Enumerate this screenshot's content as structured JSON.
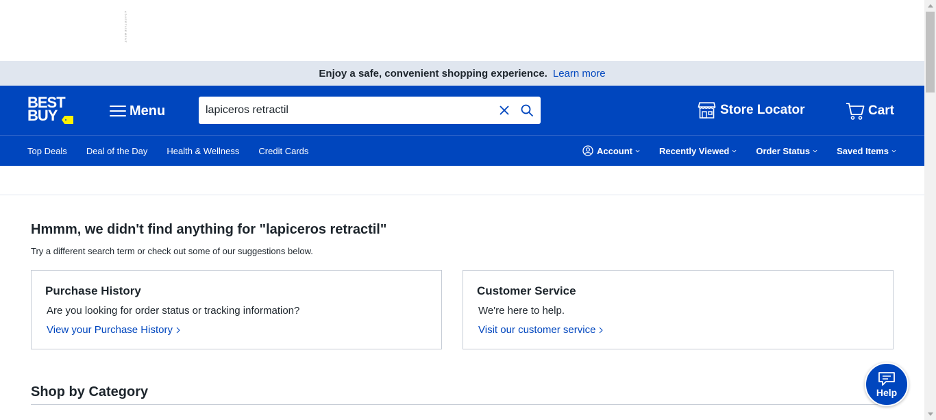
{
  "ad": {
    "label": "ADVERTISEMENT"
  },
  "promo": {
    "text": "Enjoy a safe, convenient shopping experience.",
    "link": "Learn more"
  },
  "header": {
    "logo_line1": "BEST",
    "logo_line2": "BUY",
    "menu_label": "Menu",
    "search_value": "lapiceros retractil",
    "store_locator": "Store Locator",
    "cart": "Cart"
  },
  "subnav": {
    "left": [
      "Top Deals",
      "Deal of the Day",
      "Health & Wellness",
      "Credit Cards"
    ],
    "account": "Account",
    "recently_viewed": "Recently Viewed",
    "order_status": "Order Status",
    "saved_items": "Saved Items"
  },
  "main": {
    "title": "Hmmm, we didn't find anything for \"lapiceros retractil\"",
    "subtitle": "Try a different search term or check out some of our suggestions below.",
    "cards": [
      {
        "title": "Purchase History",
        "text": "Are you looking for order status or tracking information?",
        "link": "View your Purchase History"
      },
      {
        "title": "Customer Service",
        "text": "We're here to help.",
        "link": "Visit our customer service"
      }
    ],
    "shop_by_category": "Shop by Category"
  },
  "help": {
    "label": "Help"
  },
  "colors": {
    "brand_blue": "#0046be",
    "brand_yellow": "#fff200",
    "promo_bg": "#e0e6ef",
    "text": "#1d252c"
  }
}
